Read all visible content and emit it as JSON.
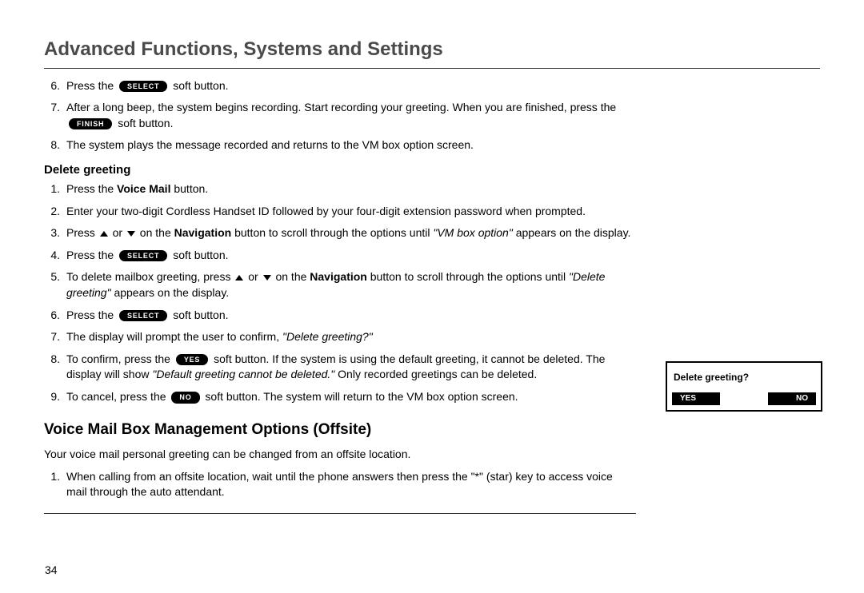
{
  "header": {
    "title": "Advanced Functions, Systems and Settings"
  },
  "top_steps": [
    {
      "n": "6.",
      "pre": "Press the ",
      "btn": "SELECT",
      "post": " soft button."
    },
    {
      "n": "7.",
      "text": "After a long beep, the system begins recording. Start recording your greeting. When you are finished, press the ",
      "btn": "FINISH",
      "post": " soft button."
    },
    {
      "n": "8.",
      "text": "The system plays the message recorded and returns to the VM box option screen."
    }
  ],
  "delete": {
    "heading": "Delete greeting",
    "steps": {
      "s1": {
        "n": "1.",
        "pre": "Press the ",
        "bold": "Voice Mail",
        "post": " button."
      },
      "s2": {
        "n": "2.",
        "text": "Enter your two-digit Cordless Handset ID followed by your four-digit extension password when prompted."
      },
      "s3": {
        "n": "3.",
        "pre": "Press ",
        "mid1": " or ",
        "mid2": " on the ",
        "bold": "Navigation",
        "post": " button to scroll through the options until ",
        "ital": "\"VM box option\"",
        "tail": " appears on the display."
      },
      "s4": {
        "n": "4.",
        "pre": "Press the ",
        "btn": "SELECT",
        "post": " soft button."
      },
      "s5": {
        "n": "5.",
        "pre": "To delete mailbox greeting, press ",
        "mid1": " or ",
        "mid2": " on the ",
        "bold": "Navigation",
        "post": " button to scroll through the options until  ",
        "ital": "\"Delete greeting\"",
        "tail": " appears on the display."
      },
      "s6": {
        "n": "6.",
        "pre": "Press the ",
        "btn": "SELECT",
        "post": " soft button."
      },
      "s7": {
        "n": "7.",
        "pre": "The display will prompt the user to confirm, ",
        "ital": "\"Delete greeting?\""
      },
      "s8": {
        "n": "8.",
        "pre": "To confirm, press the ",
        "btn": "YES",
        "post": " soft button. If the system is using the default greeting, it cannot be deleted. The display will show ",
        "ital": "\"Default greeting cannot be deleted.\"",
        "tail": " Only recorded greetings can be deleted."
      },
      "s9": {
        "n": "9.",
        "pre": "To cancel, press the ",
        "btn": "NO",
        "post": " soft button. The system will return to the VM box option screen."
      }
    }
  },
  "offsite": {
    "heading": "Voice Mail Box Management Options (Offsite)",
    "intro": "Your voice mail personal greeting can be changed from an offsite location.",
    "s1": {
      "n": "1.",
      "text": "When calling from an offsite location, wait until the phone answers then press the  \"*\" (star) key to access voice mail through the auto attendant."
    }
  },
  "screen": {
    "prompt": "Delete greeting?",
    "left": "YES",
    "right": "NO"
  },
  "page": "34"
}
